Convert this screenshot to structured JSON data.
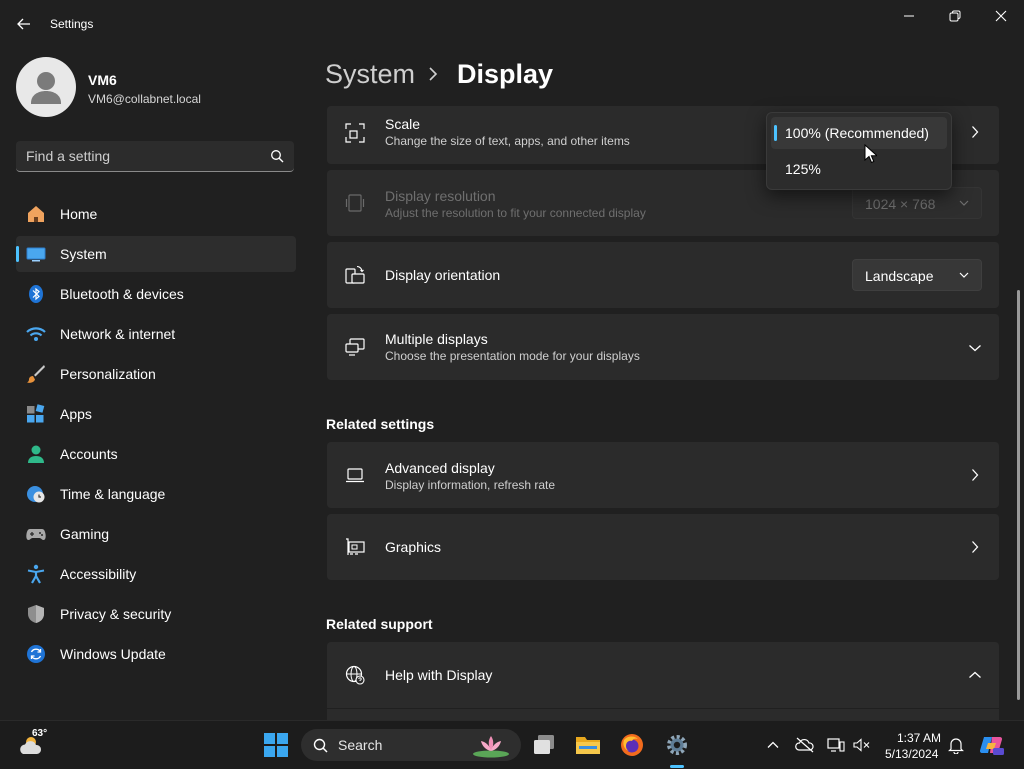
{
  "window": {
    "title": "Settings",
    "back_icon": "back-arrow-icon",
    "controls": [
      "minimize-icon",
      "restore-icon",
      "close-icon"
    ]
  },
  "profile": {
    "name": "VM6",
    "email": "VM6@collabnet.local"
  },
  "search": {
    "placeholder": "Find a setting"
  },
  "nav": {
    "items": [
      {
        "label": "Home",
        "icon": "home-icon"
      },
      {
        "label": "System",
        "icon": "system-icon",
        "active": true
      },
      {
        "label": "Bluetooth & devices",
        "icon": "bluetooth-icon"
      },
      {
        "label": "Network & internet",
        "icon": "network-icon"
      },
      {
        "label": "Personalization",
        "icon": "brush-icon"
      },
      {
        "label": "Apps",
        "icon": "apps-icon"
      },
      {
        "label": "Accounts",
        "icon": "accounts-icon"
      },
      {
        "label": "Time & language",
        "icon": "clock-globe-icon"
      },
      {
        "label": "Gaming",
        "icon": "gamepad-icon"
      },
      {
        "label": "Accessibility",
        "icon": "accessibility-icon"
      },
      {
        "label": "Privacy & security",
        "icon": "shield-icon"
      },
      {
        "label": "Windows Update",
        "icon": "update-icon"
      }
    ]
  },
  "header": {
    "parent": "System",
    "current": "Display"
  },
  "settings": {
    "scale": {
      "title": "Scale",
      "subtitle": "Change the size of text, apps, and other items"
    },
    "resolution": {
      "title": "Display resolution",
      "subtitle": "Adjust the resolution to fit your connected display",
      "value": "1024 × 768"
    },
    "orientation": {
      "title": "Display orientation",
      "value": "Landscape"
    },
    "multiple": {
      "title": "Multiple displays",
      "subtitle": "Choose the presentation mode for your displays"
    }
  },
  "scale_flyout": {
    "options": [
      {
        "label": "100% (Recommended)",
        "selected": true
      },
      {
        "label": "125%",
        "selected": false
      }
    ]
  },
  "related_settings": {
    "title": "Related settings",
    "advanced": {
      "title": "Advanced display",
      "subtitle": "Display information, refresh rate"
    },
    "graphics": {
      "title": "Graphics"
    }
  },
  "related_support": {
    "title": "Related support",
    "help": {
      "title": "Help with Display"
    }
  },
  "taskbar": {
    "weather_temp": "63°",
    "search_label": "Search",
    "clock_time": "1:37 AM",
    "clock_date": "5/13/2024",
    "accent": "#4cc2ff"
  }
}
